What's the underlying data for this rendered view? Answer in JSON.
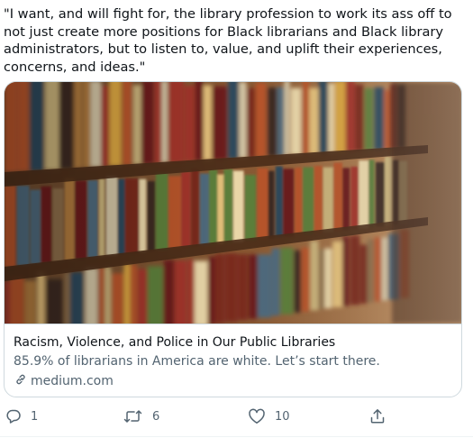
{
  "tweet": {
    "text": "\"I want, and will fight for, the library profession to work its ass off to not just create more positions for Black librarians and Black library administrators, but to listen to, value, and uplift their experiences, concerns, and ideas.\""
  },
  "card": {
    "image_icon": "bookshelf-photo",
    "title": "Racism, Violence, and Police in Our Public Libraries",
    "description": "85.9% of librarians in America are white. Let’s start there.",
    "domain_icon": "link-icon",
    "domain": "medium.com"
  },
  "actions": {
    "reply": {
      "icon": "reply-icon",
      "count": "1"
    },
    "retweet": {
      "icon": "retweet-icon",
      "count": "6"
    },
    "like": {
      "icon": "heart-icon",
      "count": "10"
    },
    "share": {
      "icon": "share-icon"
    }
  },
  "colors": {
    "text_primary": "#0f1419",
    "text_secondary": "#536471",
    "border": "#cfd9de"
  }
}
